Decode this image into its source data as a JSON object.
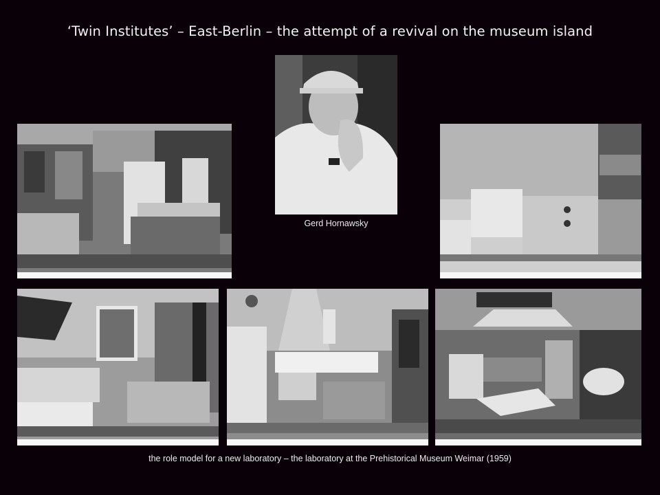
{
  "slide": {
    "title": "‘Twin Institutes’ – East-Berlin – the attempt of a revival on the museum island",
    "portrait_caption": "Gerd Hornawsky",
    "bottom_caption": "the role model for a new laboratory – the laboratory at the Prehistorical Museum Weimar (1959)"
  },
  "colors": {
    "background": "#0a0008",
    "text": "#f2f2f2"
  }
}
